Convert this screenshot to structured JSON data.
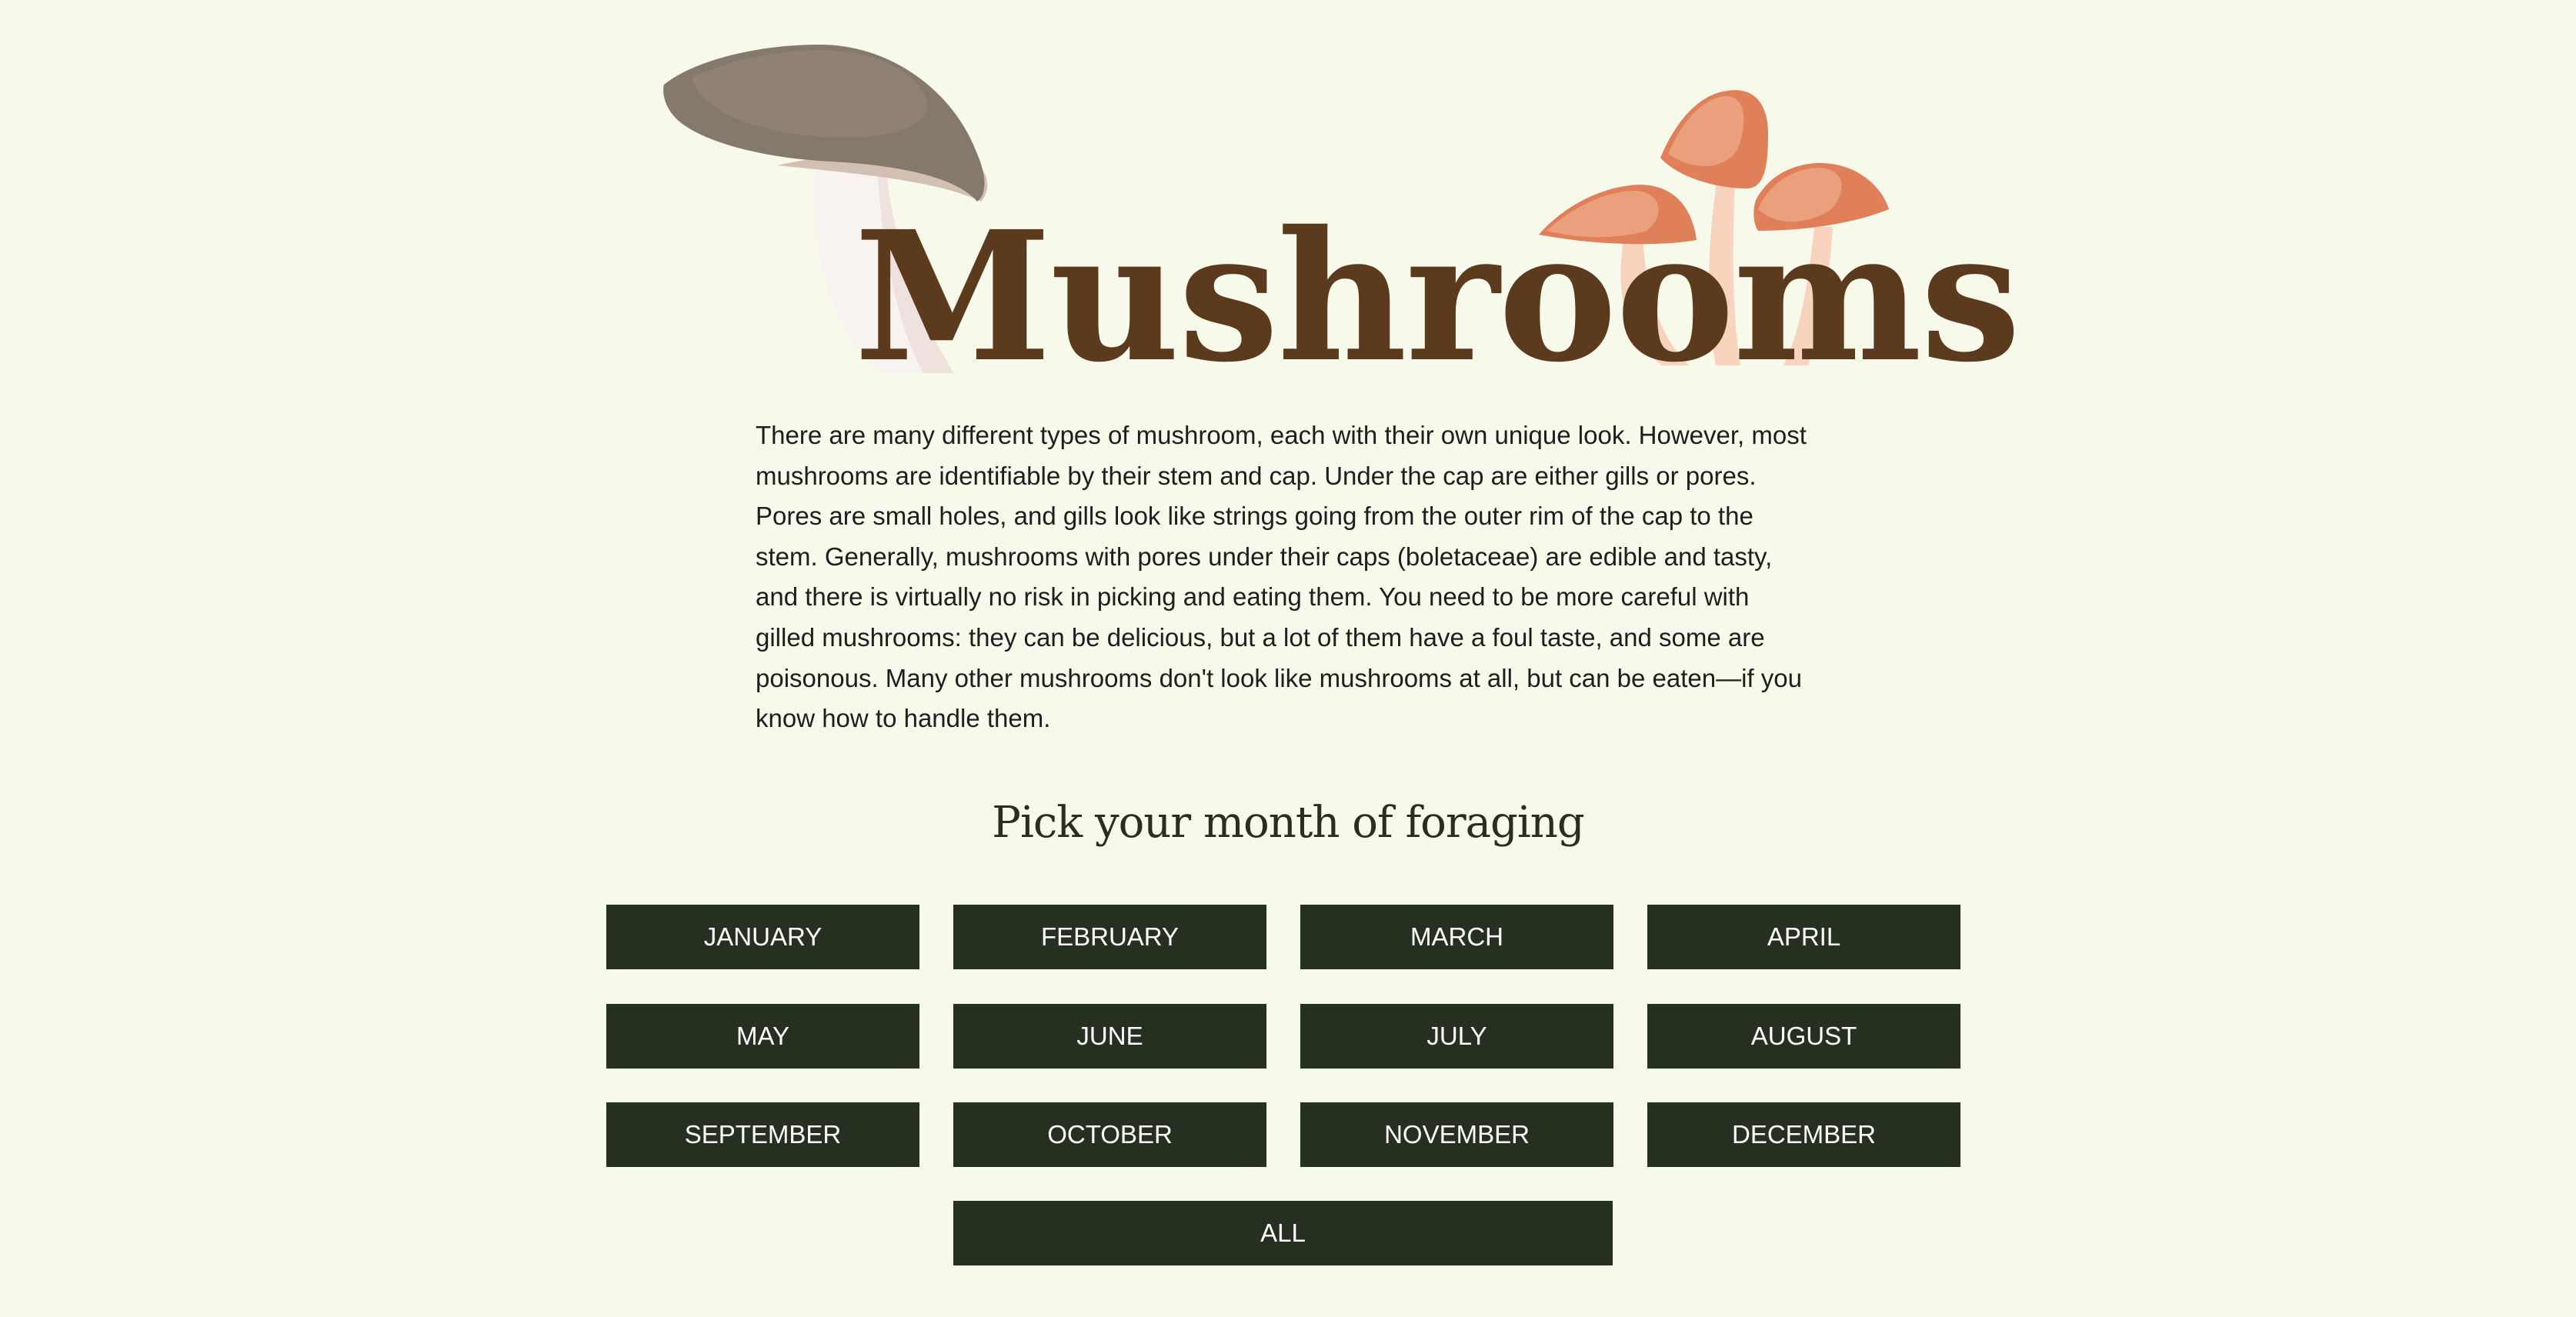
{
  "colors": {
    "background": "#F7F9EB",
    "title": "#5C3A1E",
    "body_text": "#1E1E1E",
    "heading": "#2A2E22",
    "button_bg": "#263020",
    "button_text": "#FFFFFF",
    "gray_cap": "#85796D",
    "gray_cap_underside": "#D2C0B2",
    "white_stem": "#F8F3F1",
    "orange_cap": "#E7936A",
    "orange_stem": "#F8D3BE"
  },
  "hero": {
    "title": "Mushrooms",
    "illustrations": [
      "gray-mushroom-illustration",
      "orange-mushrooms-illustration"
    ]
  },
  "intro": {
    "text": "There are many different types of mushroom, each with their own unique look. However, most mushrooms are identifiable by their stem and cap. Under the cap are either gills or pores. Pores are small holes, and gills look like strings going from the outer rim of the cap to the stem. Generally, mushrooms with pores under their caps (boletaceae) are edible and tasty, and there is virtually no risk in picking and eating them. You need to be more careful with gilled mushrooms: they can be delicious, but a lot of them have a foul taste, and some are poisonous. Many other mushrooms don't look like mushrooms at all, but can be eaten—if you know how to handle them."
  },
  "foraging": {
    "heading": "Pick your month of foraging",
    "months": [
      "JANUARY",
      "FEBRUARY",
      "MARCH",
      "APRIL",
      "MAY",
      "JUNE",
      "JULY",
      "AUGUST",
      "SEPTEMBER",
      "OCTOBER",
      "NOVEMBER",
      "DECEMBER"
    ],
    "all_label": "ALL"
  }
}
